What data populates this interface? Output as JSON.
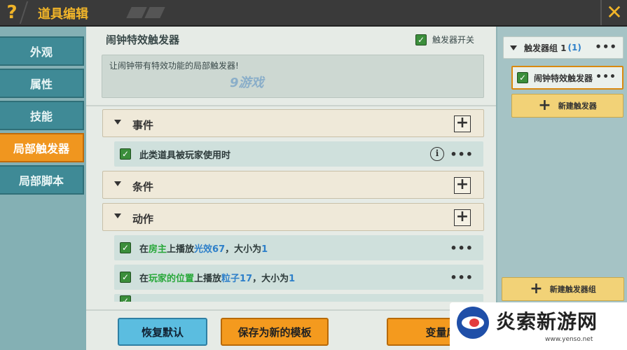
{
  "topbar": {
    "help_icon": "?",
    "title": "道具编辑",
    "close_icon": "✕"
  },
  "sidebar": {
    "items": [
      {
        "label": "外观",
        "active": false
      },
      {
        "label": "属性",
        "active": false
      },
      {
        "label": "技能",
        "active": false
      },
      {
        "label": "局部触发器",
        "active": true
      },
      {
        "label": "局部脚本",
        "active": false
      }
    ]
  },
  "main": {
    "title": "闹钟特效触发器",
    "trigger_switch_label": "触发器开关",
    "trigger_switch_checked": true,
    "description": "让闹钟带有特效功能的局部触发器!",
    "watermark": "9游戏",
    "groups": {
      "event": {
        "label": "事件"
      },
      "condition": {
        "label": "条件"
      },
      "action": {
        "label": "动作"
      }
    },
    "event_row": {
      "text": "此类道具被玩家使用时",
      "checked": true,
      "info_icon": "i"
    },
    "action_rows": [
      {
        "pre": "在",
        "hl1": "房主",
        "mid": "上播放",
        "hl2": "光效67",
        "mid2": "，大小为",
        "hl3": "1"
      },
      {
        "pre": "在",
        "hl1": "玩家的位置",
        "mid": "上播放",
        "hl2": "粒子17",
        "mid2": "，大小为",
        "hl3": "1"
      }
    ],
    "more_icon": "•••"
  },
  "bottom": {
    "reset_label": "恢复默认",
    "save_template_label": "保存为新的模板",
    "variables_label": "变量库"
  },
  "right": {
    "group_label": "触发器组 1",
    "group_count": "(1)",
    "trigger_item_label": "闹钟特效触发器",
    "new_trigger_label": "新建触发器",
    "new_group_label": "新建触发器组",
    "plus_icon": "+"
  },
  "site": {
    "name": "炎索新游网",
    "url": "www.yenso.net"
  },
  "colors": {
    "accent_orange": "#f49a1e",
    "nav_teal": "#3f8a96",
    "highlight_green": "#29a83b",
    "highlight_blue": "#2d7fc9",
    "check_green": "#3b8e3b"
  }
}
